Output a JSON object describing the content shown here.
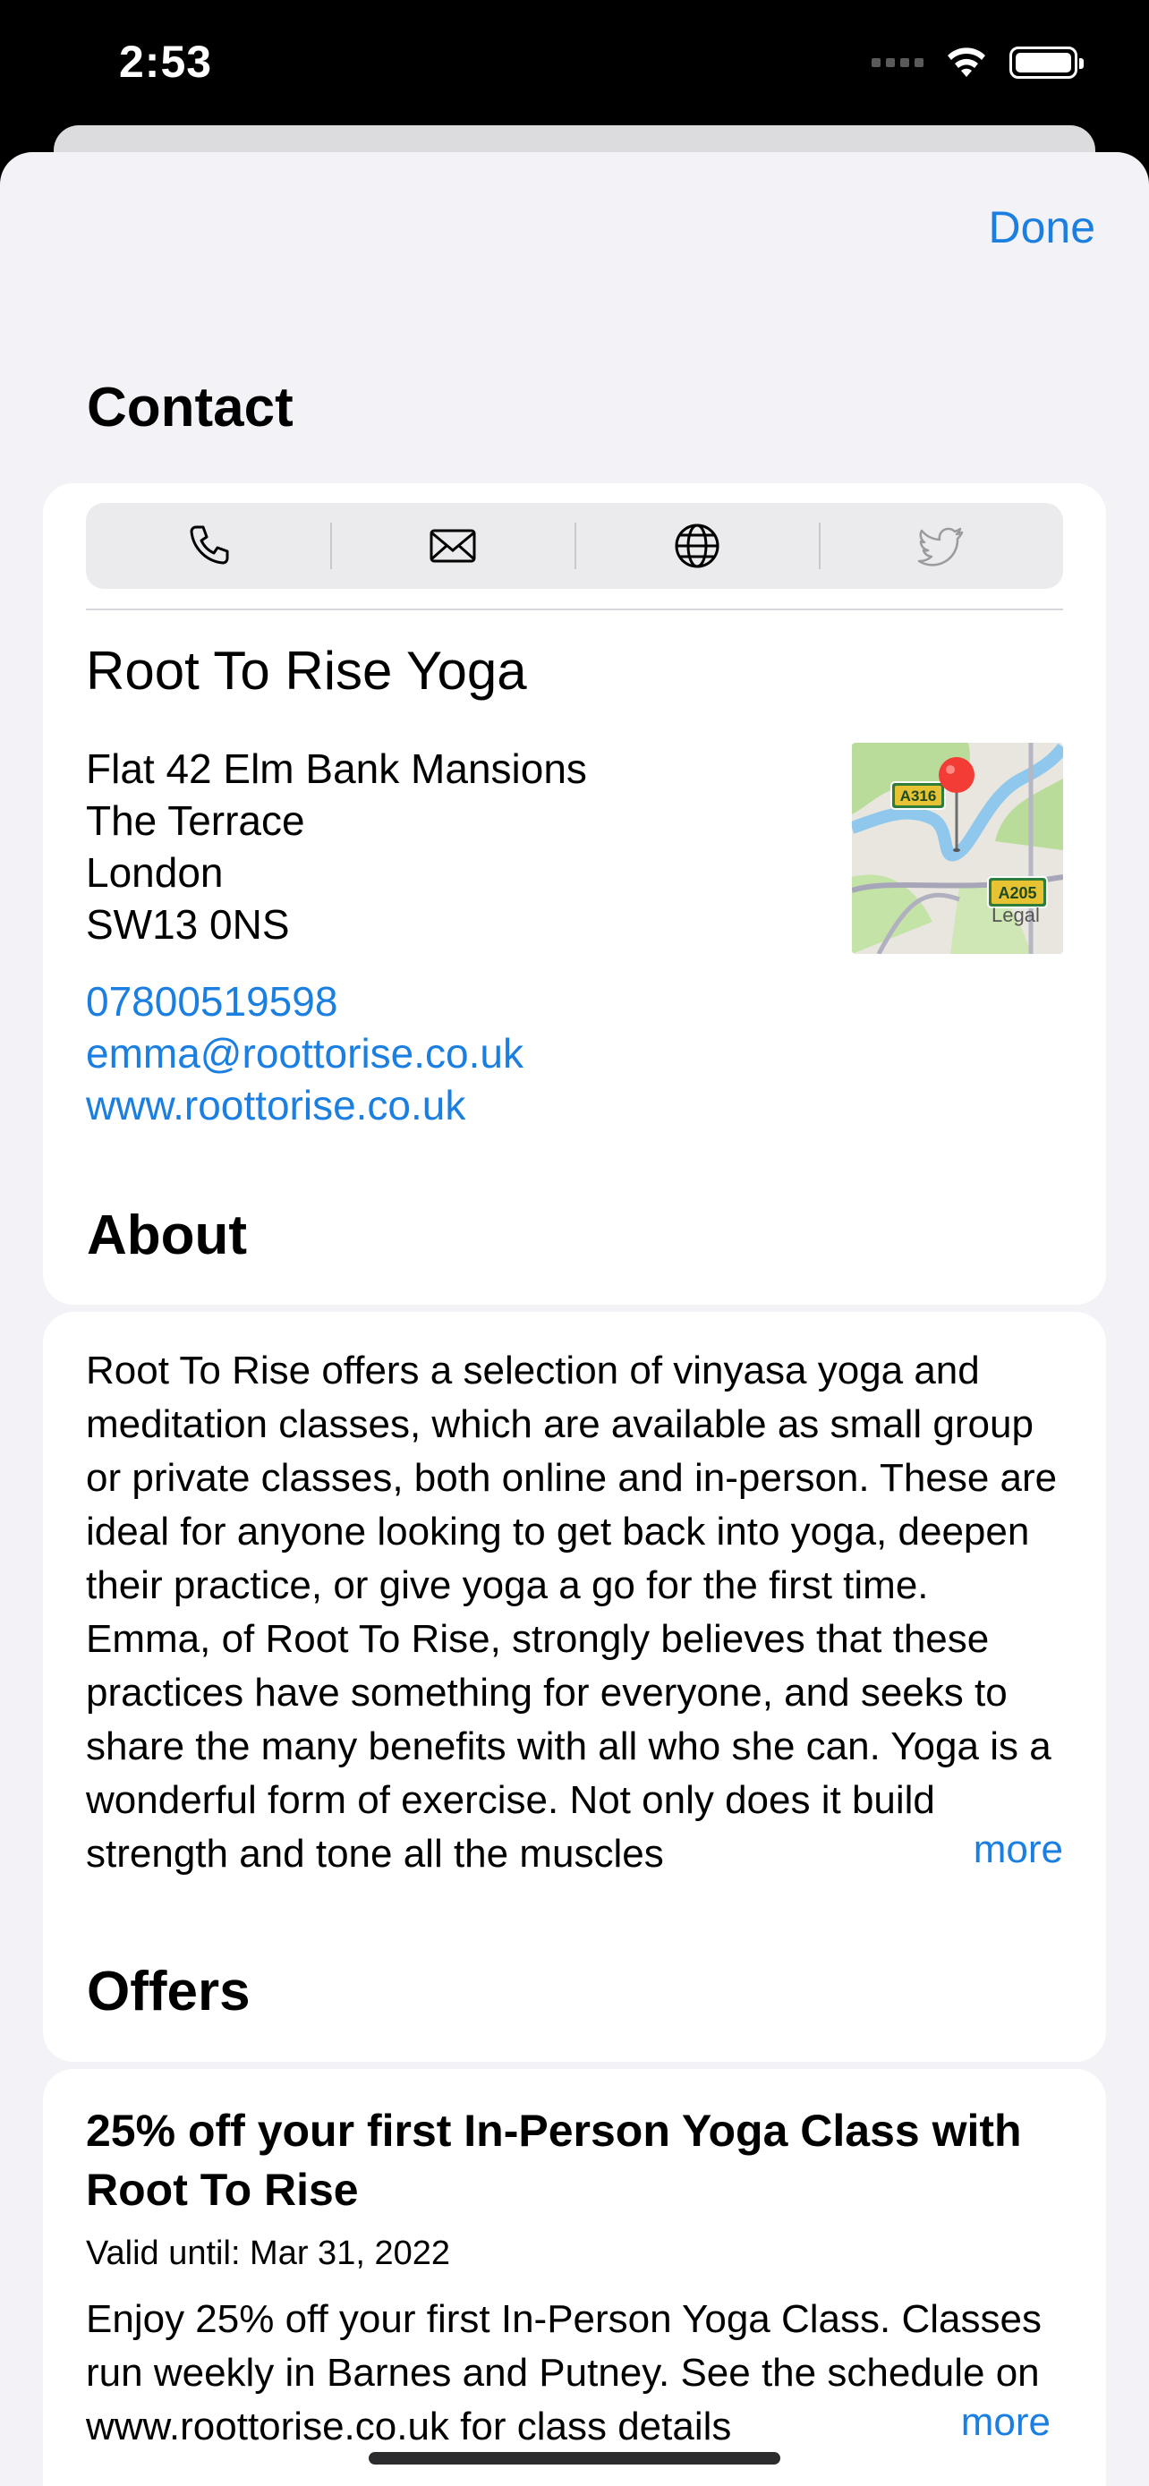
{
  "status_bar": {
    "time": "2:53"
  },
  "header": {
    "done_label": "Done"
  },
  "contact": {
    "section_title": "Contact",
    "action_icons": [
      "phone-icon",
      "mail-icon",
      "globe-icon",
      "twitter-icon"
    ],
    "business_name": "Root To Rise Yoga",
    "address_lines": [
      "Flat 42 Elm Bank Mansions",
      "The Terrace",
      "London",
      "SW13 0NS"
    ],
    "phone": "07800519598",
    "email": "emma@roottorise.co.uk",
    "website": "www.roottorise.co.uk",
    "map": {
      "road_labels": [
        "A316",
        "A205"
      ],
      "legal_label": "Legal"
    }
  },
  "about": {
    "section_title": "About",
    "text": "Root To Rise offers a selection of vinyasa yoga and meditation classes, which are available as small group or private classes, both online and in-person. These are ideal for anyone looking to get back into yoga, deepen their practice, or give yoga a go for the first time. Emma, of Root To Rise, strongly believes that these practices have something for everyone, and seeks to share the many benefits with all who she can. Yoga is a wonderful form of exercise. Not only does it build strength and tone all the muscles",
    "more_label": "more"
  },
  "offers": {
    "section_title": "Offers",
    "items": [
      {
        "title": "25% off your first In-Person Yoga Class with Root To Rise",
        "valid_until": "Valid until: Mar 31, 2022",
        "description": "Enjoy 25% off your first In-Person Yoga Class. Classes run weekly in Barnes and Putney. See the schedule on www.roottorise.co.uk for class details",
        "more_label": "more"
      }
    ]
  }
}
